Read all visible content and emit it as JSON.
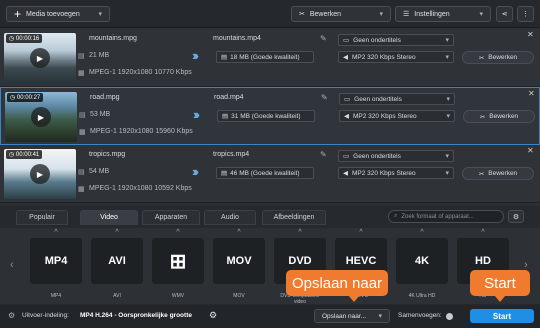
{
  "toolbar": {
    "add_media": "Media toevoegen",
    "edit": "Bewerken",
    "settings": "Instellingen"
  },
  "files": [
    {
      "duration": "00:00:16",
      "name": "mountains.mpg",
      "size": "21 MB",
      "codec": "MPEG-1 1920x1080 10770 Kbps",
      "out_name": "mountains.mp4",
      "out_size": "18 MB (Goede kwaliteit)",
      "subs": "Geen ondertitels",
      "audio": "MP2 320 Kbps Stereo",
      "edit": "Bewerken"
    },
    {
      "duration": "00:00:27",
      "name": "road.mpg",
      "size": "53 MB",
      "codec": "MPEG-1 1920x1080 15960 Kbps",
      "out_name": "road.mp4",
      "out_size": "31 MB (Goede kwaliteit)",
      "subs": "Geen ondertitels",
      "audio": "MP2 320 Kbps Stereo",
      "edit": "Bewerken"
    },
    {
      "duration": "00:00:41",
      "name": "tropics.mpg",
      "size": "54 MB",
      "codec": "MPEG-1 1920x1080 10592 Kbps",
      "out_name": "tropics.mp4",
      "out_size": "46 MB (Goede kwaliteit)",
      "subs": "Geen ondertitels",
      "audio": "MP2 320 Kbps Stereo",
      "edit": "Bewerken"
    }
  ],
  "tabs": [
    "Populair",
    "Video",
    "Apparaten",
    "Audio",
    "Afbeeldingen"
  ],
  "search_placeholder": "Zoek formaat of apparaat...",
  "formats": [
    {
      "icon": "MP4",
      "label": "MP4"
    },
    {
      "icon": "AVI",
      "label": "AVI"
    },
    {
      "icon": "⊞",
      "label": "WMV"
    },
    {
      "icon": "MOV",
      "label": "MOV"
    },
    {
      "icon": "DVD",
      "label": "DVD-compatibele video"
    },
    {
      "icon": "HEVC",
      "label": "HEVC"
    },
    {
      "icon": "4K",
      "label": "4K Ultra HD"
    },
    {
      "icon": "HD",
      "label": "HD"
    }
  ],
  "status": {
    "output_label": "Uitvoer-indeling:",
    "output_value": "MP4 H.264 - Oorspronkelijke grootte",
    "save": "Opslaan naar...",
    "merge": "Samenvoegen:",
    "start": "Start"
  },
  "callouts": {
    "save": "Opslaan naar",
    "start": "Start"
  }
}
